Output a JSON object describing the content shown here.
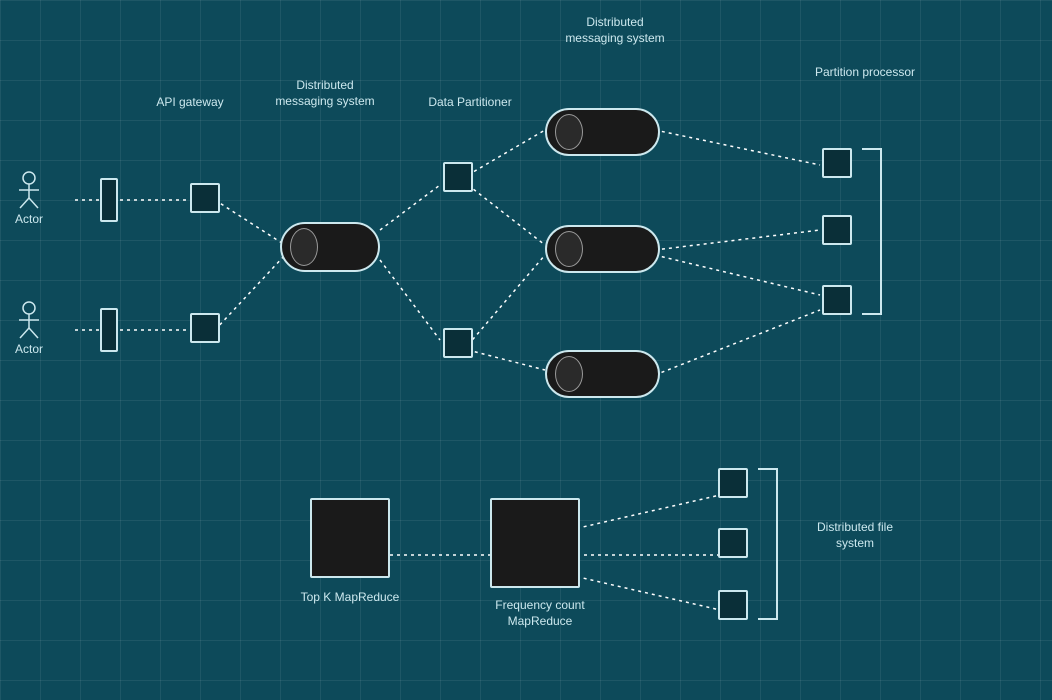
{
  "labels": {
    "actor1": "Actor",
    "actor2": "Actor",
    "api_gateway": "API\ngateway",
    "distributed_msg1": "Distributed\nmessaging\nsystem",
    "distributed_msg2": "Distributed\nmessaging\nsystem",
    "data_partitioner": "Data\nPartitioner",
    "partition_processor": "Partition\nprocessor",
    "top_k_mapreduce": "Top K\nMapReduce",
    "freq_count_mapreduce": "Frequency\ncount\nMapReduce",
    "distributed_fs": "Distributed\nfile system"
  }
}
